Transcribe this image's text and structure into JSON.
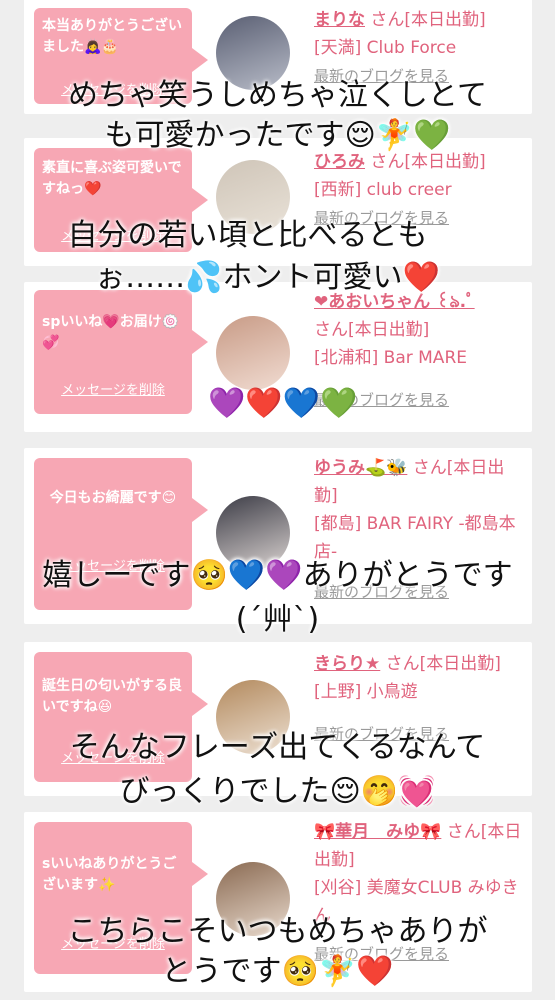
{
  "cards": [
    {
      "message": "本当ありがとうございました🙇‍♀️🎂",
      "delete_label": "メッセージを削除",
      "name": "まりな",
      "suffix": " さん[本日出勤]",
      "shop": "[天満] Club Force",
      "blog": "最新のブログを見る",
      "avatar_colors": [
        "#5a5f73",
        "#b8bcc8"
      ]
    },
    {
      "message": "素直に喜ぶ姿可愛いですねっ❤️",
      "delete_label": "メッセージを削除",
      "name": "ひろみ",
      "suffix": " さん[本日出勤]",
      "shop": "[西新] club creer",
      "blog": "最新のブログを見る",
      "avatar_colors": [
        "#cfc5b8",
        "#e9e2d8"
      ]
    },
    {
      "message": "spいいね💗お届け🍥💞",
      "delete_label": "メッセージを削除",
      "name": "❤︎あおいちゃん ꒰ঌ.ﾟ",
      "suffix": "さん[本日出勤]",
      "shop": "[北浦和] Bar MARE",
      "blog": "最新のブログを見る",
      "avatar_colors": [
        "#c89b86",
        "#f1dcd2"
      ]
    },
    {
      "message": "今日もお綺麗です😊",
      "delete_label": "メッセージを削除",
      "name": "ゆうみ⛳🐝",
      "suffix": " さん[本日出勤]",
      "shop": "[都島] BAR FAIRY -都島本店-",
      "blog": "最新のブログを見る",
      "avatar_colors": [
        "#3c3c46",
        "#d9d2d0"
      ]
    },
    {
      "message": "誕生日の匂いがする良いですね😆",
      "delete_label": "メッセージを削除",
      "name": "きらり★",
      "suffix": " さん[本日出勤]",
      "shop": "[上野] 小鳥遊",
      "blog": "最新のブログを見る",
      "avatar_colors": [
        "#b38a5e",
        "#ede0d2"
      ]
    },
    {
      "message": "sいいねありがとうございます✨",
      "delete_label": "メッセージを削除",
      "name": "🎀華月　みゆ🎀",
      "suffix": " さん[本日出勤]",
      "shop": "[刈谷] 美魔女CLUB みゆきん",
      "blog": "最新のブログを見る",
      "avatar_colors": [
        "#8a6a52",
        "#e8d9cc"
      ]
    }
  ],
  "overlays": {
    "o1a": "めちゃ笑うしめちゃ泣くしとて",
    "o1b": "も可愛かったです😌🧚💚",
    "o2a": "自分の若い頃と比べるとも",
    "o2b": "ぉ……💦ホント可愛い❤️",
    "o3": "💜❤️💙💚",
    "o4a": "嬉しーです🥺💙💜ありがとうです",
    "o4b": "(´艸`)",
    "o5a": "そんなフレーズ出てくるなんて",
    "o5b": "びっくりでした😌🤭💓",
    "o6a": "こちらこそいつもめちゃありが",
    "o6b": "とうです🥺🧚❤️"
  },
  "colors": {
    "bubble": "#f7a7b4",
    "accent": "#e0637d",
    "link_gray": "#9a9a9a"
  }
}
